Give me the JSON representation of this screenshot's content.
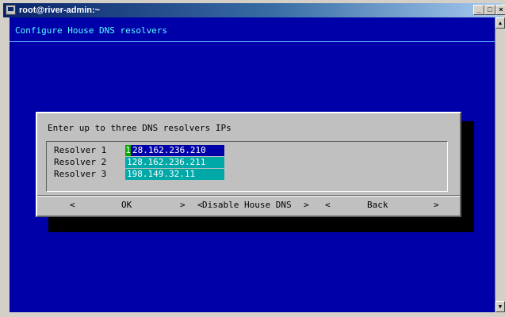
{
  "window": {
    "title": "root@river-admin:~",
    "controls": {
      "minimize": "_",
      "maximize": "□",
      "close": "×"
    }
  },
  "screen": {
    "title": "Configure House DNS resolvers"
  },
  "dialog": {
    "prompt": "Enter up to three DNS resolvers IPs",
    "resolvers": [
      {
        "label": "Resolver 1",
        "value": "128.162.236.210",
        "cursor_char": "1",
        "value_rest": "28.162.236.210"
      },
      {
        "label": "Resolver 2",
        "value": "128.162.236.211"
      },
      {
        "label": "Resolver 3",
        "value": "198.149.32.11"
      }
    ],
    "buttons": {
      "ok": {
        "left": "<",
        "label": "OK",
        "right": ">"
      },
      "disable": {
        "left": "<",
        "label": "Disable House DNS",
        "right": ">"
      },
      "back": {
        "left": "<",
        "label": "Back",
        "right": ">"
      }
    }
  },
  "colors": {
    "terminal_bg": "#0000a8",
    "title_text": "#55ffff",
    "field_bg": "#00a8a8",
    "field_active_bg": "#0000a8",
    "cursor_bg": "#00aa00",
    "dialog_bg": "#c0c0c0"
  }
}
